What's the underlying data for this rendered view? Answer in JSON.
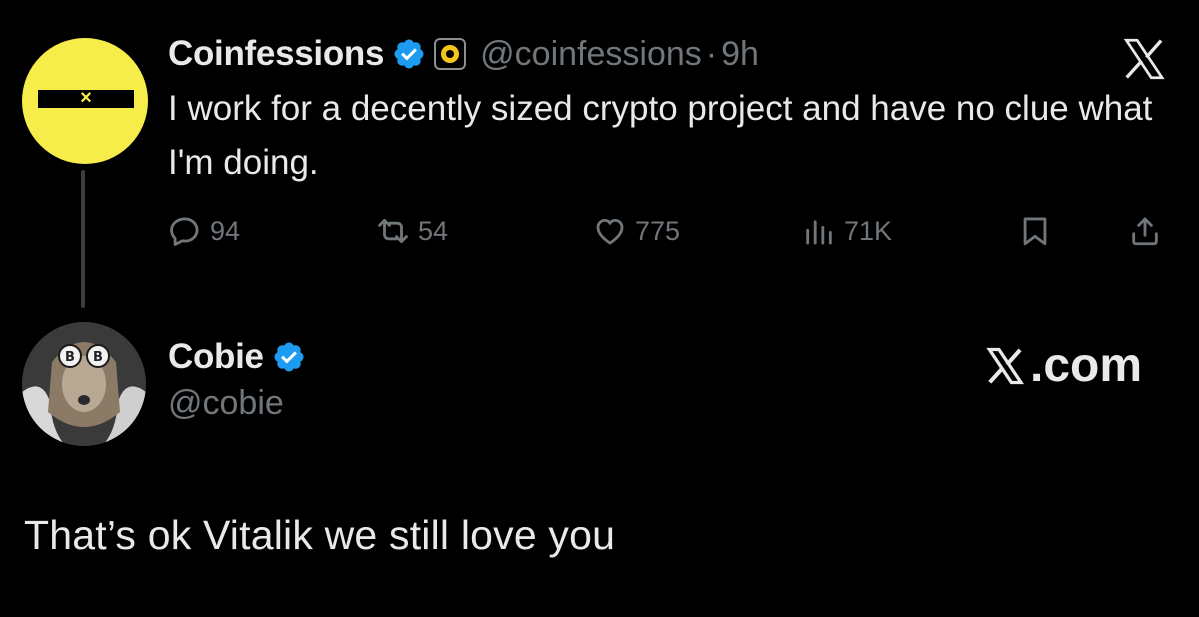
{
  "tweet1": {
    "display_name": "Coinfessions",
    "handle": "@coinfessions",
    "separator": "·",
    "time": "9h",
    "text": "I work for a decently sized crypto project and have no clue what I'm doing.",
    "stats": {
      "replies": "94",
      "reposts": "54",
      "likes": "775",
      "views": "71K"
    },
    "avatar_colors": {
      "background": "#f7ed4a",
      "bar": "#000000"
    }
  },
  "tweet2": {
    "display_name": "Cobie",
    "handle": "@cobie",
    "brand_label": ".com",
    "reply_text": "That’s ok Vitalik we still love you"
  },
  "colors": {
    "background": "#000000",
    "primary_text": "#e7e9ea",
    "secondary_text": "#71767b",
    "verified_blue": "#1d9bf0",
    "thread_line": "#3a3d41"
  },
  "icons": {
    "verified": "verified-badge-icon",
    "affiliate": "affiliate-badge-icon",
    "x_logo": "x-logo-icon",
    "reply": "reply-icon",
    "repost": "repost-icon",
    "like": "heart-icon",
    "views": "views-icon",
    "bookmark": "bookmark-icon",
    "share": "share-icon"
  }
}
